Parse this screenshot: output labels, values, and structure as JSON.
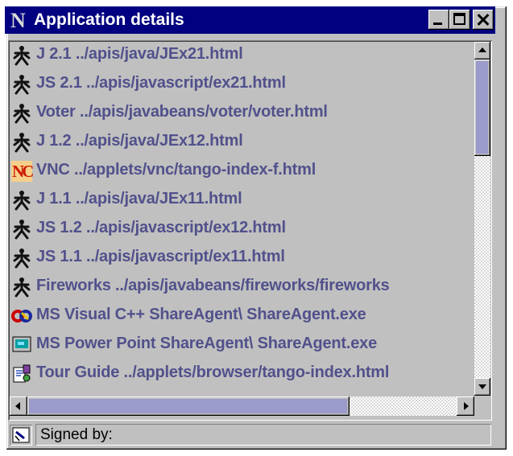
{
  "window": {
    "title": "Application details",
    "app_icon": "N",
    "controls": [
      "minimize",
      "maximize",
      "close"
    ]
  },
  "list": {
    "items": [
      {
        "icon": "person-icon",
        "label": "J 2.1 ../apis/java/JEx21.html"
      },
      {
        "icon": "person-icon",
        "label": "JS 2.1 ../apis/javascript/ex21.html"
      },
      {
        "icon": "person-icon",
        "label": "Voter ../apis/javabeans/voter/voter.html"
      },
      {
        "icon": "person-icon",
        "label": "J 1.2 ../apis/java/JEx12.html"
      },
      {
        "icon": "nc-logo-icon",
        "label": "VNC ../applets/vnc/tango-index-f.html"
      },
      {
        "icon": "person-icon",
        "label": "J 1.1 ../apis/java/JEx11.html"
      },
      {
        "icon": "person-icon",
        "label": "JS 1.2 ../apis/javascript/ex12.html"
      },
      {
        "icon": "person-icon",
        "label": "JS 1.1 ../apis/javascript/ex11.html"
      },
      {
        "icon": "person-icon",
        "label": "Fireworks ../apis/javabeans/fireworks/fireworks"
      },
      {
        "icon": "share-icon",
        "label": "MS Visual C++ ShareAgent\\ ShareAgent.exe"
      },
      {
        "icon": "monitor-icon",
        "label": "MS Power Point ShareAgent\\ ShareAgent.exe"
      },
      {
        "icon": "tour-guide-icon",
        "label": "Tour Guide ../applets/browser/tango-index.html"
      }
    ]
  },
  "status": {
    "icon": "certificate-icon",
    "text": "Signed by:"
  },
  "colors": {
    "titlebar": "#000080",
    "label_text": "#51518c",
    "scroll_thumb": "#9a9acb",
    "window_face": "#c0c0c0"
  }
}
